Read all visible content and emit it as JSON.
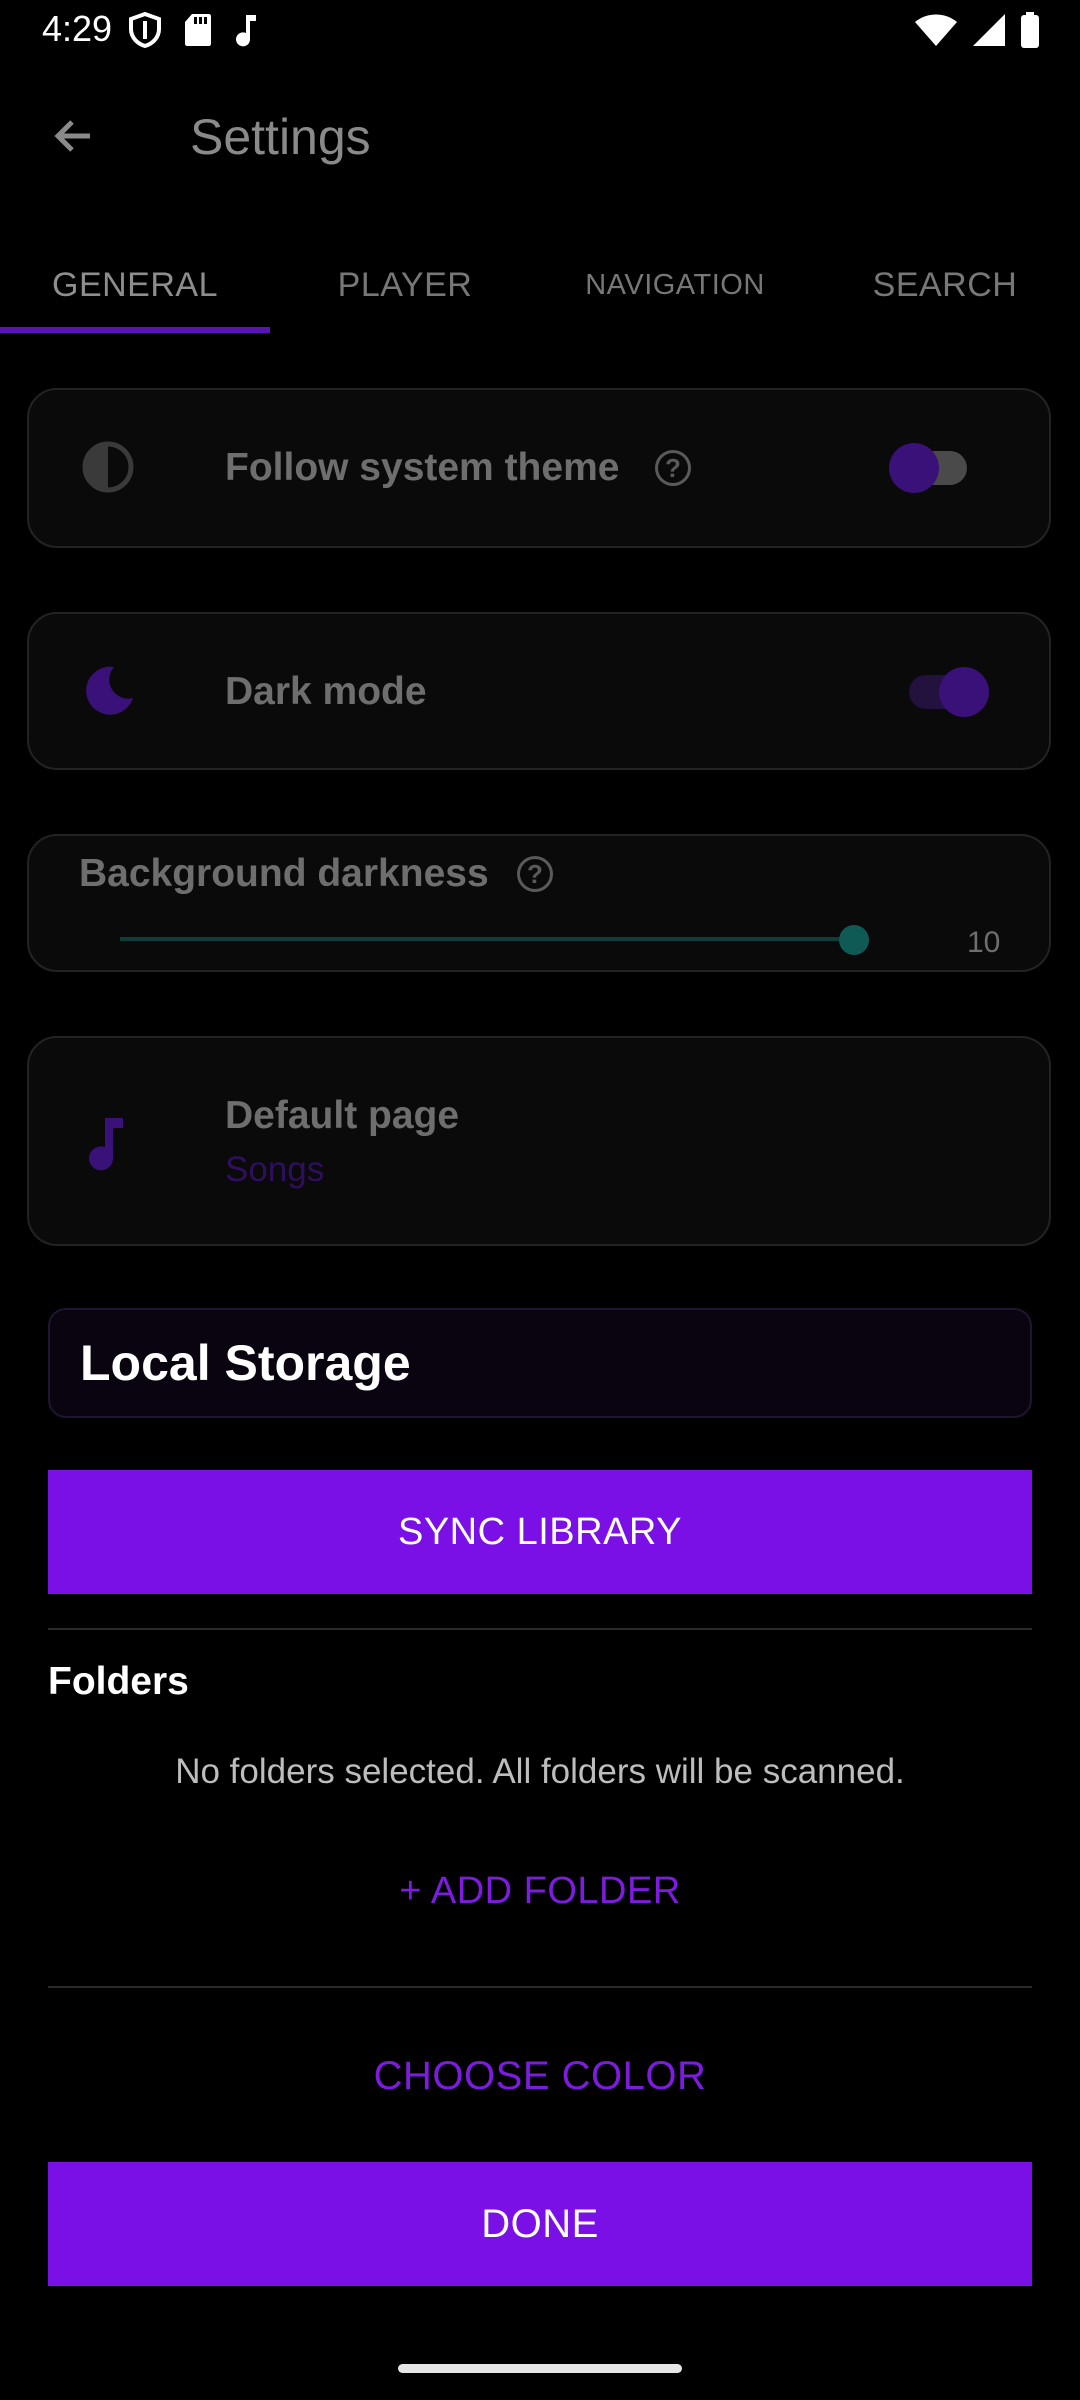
{
  "status_bar": {
    "time": "4:29",
    "left_icons": [
      "shield-icon",
      "sd-card-icon",
      "music-note-icon"
    ],
    "right_icons": [
      "wifi-icon",
      "cell-signal-icon",
      "battery-icon"
    ]
  },
  "app_bar": {
    "title": "Settings"
  },
  "tabs": [
    {
      "label": "GENERAL",
      "active": true
    },
    {
      "label": "PLAYER",
      "active": false
    },
    {
      "label": "NAVIGATION",
      "active": false
    },
    {
      "label": "SEARCH",
      "active": false
    }
  ],
  "settings": {
    "follow_system_theme": {
      "label": "Follow system theme",
      "enabled": false
    },
    "dark_mode": {
      "label": "Dark mode",
      "enabled": true
    },
    "background_darkness": {
      "label": "Background darkness",
      "value": "10",
      "fraction": 1.0
    },
    "default_page": {
      "label": "Default page",
      "value": "Songs"
    }
  },
  "local_storage": {
    "title": "Local Storage",
    "sync_button": "SYNC LIBRARY",
    "folders_title": "Folders",
    "folders_empty": "No folders selected. All folders will be scanned.",
    "add_folder": "+ ADD FOLDER"
  },
  "actions": {
    "choose_color": "CHOOSE COLOR",
    "done": "DONE"
  },
  "colors": {
    "accent": "#7a0fe6",
    "accent_dim": "#3a1178",
    "slider": "#0f5a55",
    "background": "#000000"
  }
}
